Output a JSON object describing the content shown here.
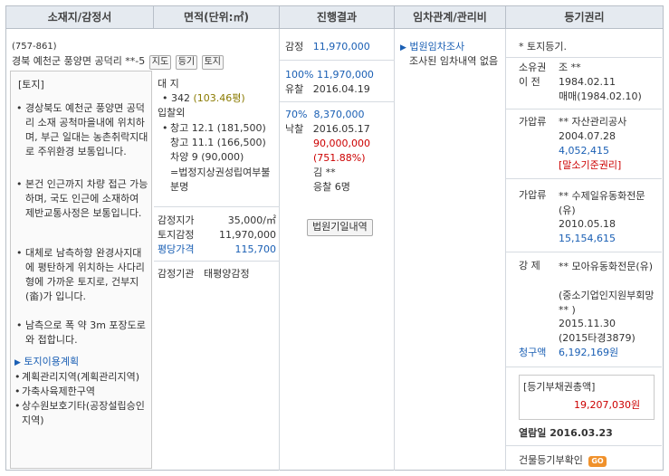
{
  "header": {
    "col1": "소재지/감정서",
    "col2": "면적(단위:㎡)",
    "col3": "진행결과",
    "col4": "임차관계/관리비",
    "col5": "등기권리"
  },
  "location": {
    "zip": "(757-861)",
    "address": "경북 예천군 풍양면 공덕리 **-5",
    "btn_map": "지도",
    "btn_registry": "등기",
    "btn_land": "토지",
    "desc_title": "[토지]",
    "desc_items": [
      "경상북도 예천군 풍양면 공덕리 소재 공척마을내에 위치하며, 부근 일대는 농촌취락지대로 주위환경 보통입니다.",
      "본건 인근까지 차량 접근 가능하며, 국도 인근에 소재하여 제반교통사정은 보통입니다.",
      "대체로 남측하향 완경사지대에 평탄하게 위치하는 사다리형에 가까운 토지로, 건부지(畓)가 입니다.",
      "남측으로 폭 약 3m 포장도로와 접합니다."
    ],
    "land_use_title": "토지이용계획",
    "land_use_items": [
      "계획관리지역(계획관리지역)",
      "가축사육제한구역",
      "상수원보호기타(공장설립승인지역)"
    ]
  },
  "area": {
    "land_label": "대 지",
    "land_area": "342",
    "land_pyeong": "(103.46평)",
    "other_label": "입찰외",
    "other_items": [
      "창고 12.1 (181,500)",
      "창고 11.1 (166,500)",
      "차양 9 (90,000)",
      "=법정지상권성립여부불분명"
    ],
    "appraisal_price_label": "감정지가",
    "appraisal_price_value": "35,000/㎡",
    "land_appraisal_label": "토지감정",
    "land_appraisal_value": "11,970,000",
    "avg_price_label": "평당가격",
    "avg_price_value": "115,700",
    "agency_label": "감정기관",
    "agency_value": "태평양감정"
  },
  "progress": {
    "appraisal_label": "감정",
    "appraisal_value": "11,970,000",
    "r1_pct": "100%",
    "r1_value": "11,970,000",
    "r1_result": "유찰",
    "r1_date": "2016.04.19",
    "r2_pct": "70%",
    "r2_value": "8,370,000",
    "r2_result": "낙찰",
    "r2_date": "2016.05.17",
    "r2_bid": "90,000,000",
    "r2_ratio": "(751.88%)",
    "r2_winner": "김 **",
    "r2_bidders": "응찰 6명",
    "court_button": "법원기일내역"
  },
  "tenant": {
    "link": "법원임차조사",
    "note": "조사된 임차내역 없음"
  },
  "rights": {
    "land_registry": "* 토지등기.",
    "owner_label": "소유권",
    "owner_name": "조 **",
    "transfer_label": "이  전",
    "transfer_date": "1984.02.11",
    "transfer_cause": "매매(1984.02.10)",
    "seizure1_label": "가압류",
    "seizure1_holder": "** 자산관리공사",
    "seizure1_date": "2004.07.28",
    "seizure1_amount": "4,052,415",
    "seizure1_note": "[말소기준권리]",
    "seizure2_label": "가압류",
    "seizure2_holder": "** 수제일유동화전문(유)",
    "seizure2_date": "2010.05.18",
    "seizure2_amount": "15,154,615",
    "forced_label": "강  제",
    "forced_holder": "** 모아유동화전문(유)",
    "forced_sub": "(중소기업인지원부회망 ** )",
    "forced_date": "2015.11.30",
    "forced_case": "(2015타경3879)",
    "claim_label": "청구액",
    "claim_value": "6,192,169원",
    "total_debt_label": "[등기부채권총액]",
    "total_debt_value": "19,207,030원",
    "viewed_label": "열람일",
    "viewed_date": "2016.03.23",
    "building_check": "건물등기부확인",
    "go": "GO"
  },
  "colors": {
    "header_bg": "#e5eaf0",
    "border": "#b8bfc8",
    "link_blue": "#1a5fb4",
    "red": "#cc0000",
    "go_orange": "#f0912b"
  }
}
